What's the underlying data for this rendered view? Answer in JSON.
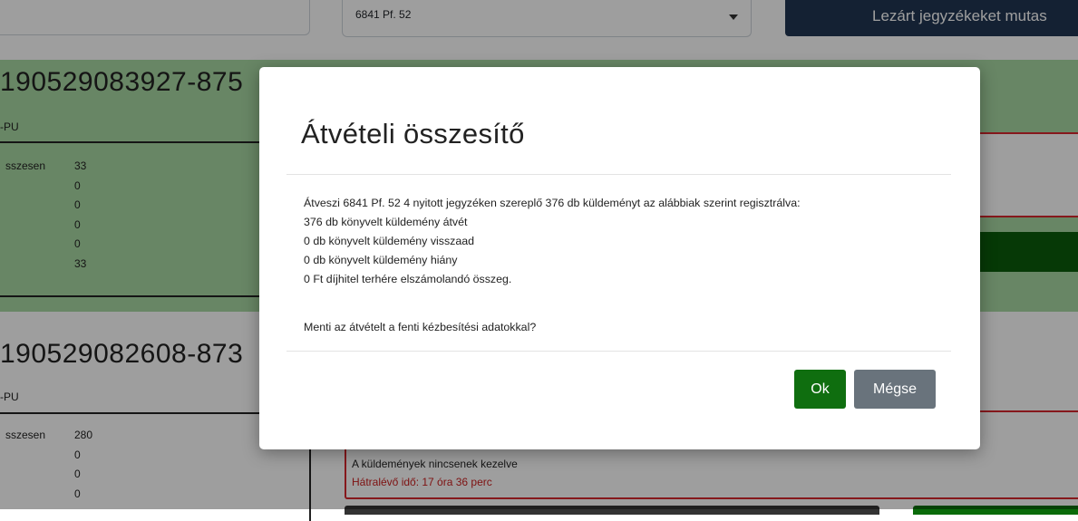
{
  "topbar": {
    "select_value": "6841 Pf. 52",
    "closed_button_label": "Lezárt jegyzékeket mutas"
  },
  "cards": [
    {
      "title": "190529083927-875",
      "subtitle": "-PU",
      "stats": [
        {
          "label": "sszesen",
          "value": "33"
        },
        {
          "label": "",
          "value": "0"
        },
        {
          "label": "",
          "value": "0"
        },
        {
          "label": "",
          "value": "0"
        },
        {
          "label": "",
          "value": "0"
        },
        {
          "label": "",
          "value": "33"
        }
      ]
    },
    {
      "title": "190529082608-873",
      "subtitle": "-PU",
      "stats": [
        {
          "label": "sszesen",
          "value": "280"
        },
        {
          "label": "",
          "value": "0"
        },
        {
          "label": "",
          "value": "0"
        },
        {
          "label": "",
          "value": "0"
        }
      ],
      "status_text": "A küldemények nincsenek kezelve",
      "remaining_time": "Hátralévő idő: 17 óra 36 perc"
    }
  ],
  "modal": {
    "title": "Átvételi összesítő",
    "lines": [
      "Átveszi 6841 Pf. 52 4 nyitott jegyzéken szereplő 376 db küldeményt az alábbiak szerint regisztrálva:",
      "376 db könyvelt küldemény átvét",
      "0 db könyvelt küldemény visszaad",
      "0 db könyvelt küldemény hiány",
      "0 Ft díjhitel terhére elszámolandó összeg."
    ],
    "question": "Menti az átvételt a fenti kézbesítési adatokkal?",
    "ok_label": "Ok",
    "cancel_label": "Mégse"
  },
  "colors": {
    "card_highlight": "#a9d8a4",
    "dark_navy_button": "#213653",
    "ok_button": "#0f6e0f",
    "cancel_button": "#69737c",
    "alert_red": "#d9272e"
  }
}
